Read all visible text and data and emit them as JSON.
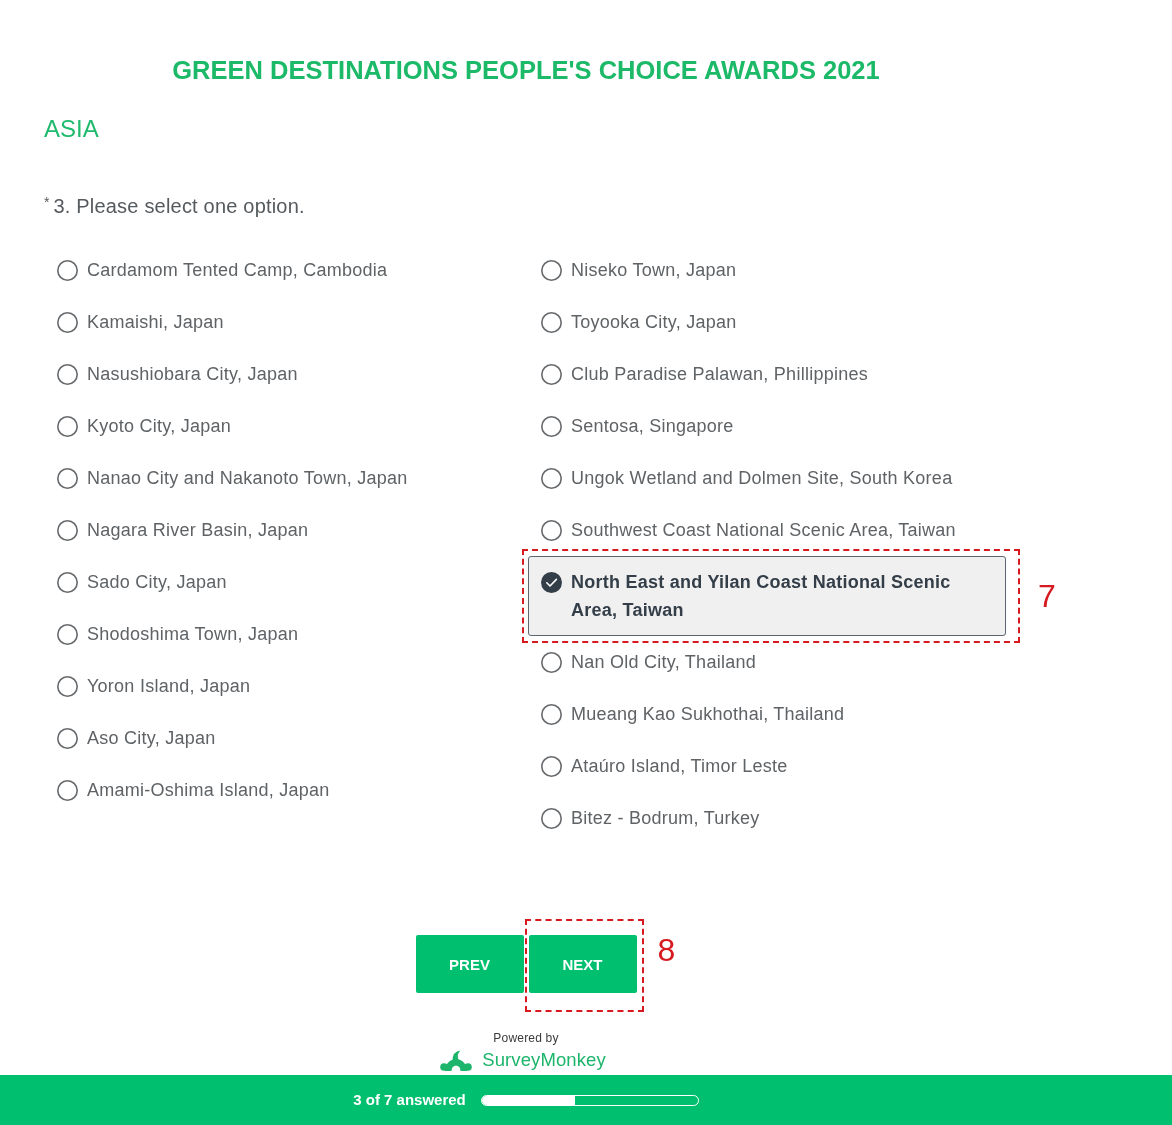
{
  "title": "GREEN DESTINATIONS PEOPLE'S CHOICE AWARDS 2021",
  "section": "ASIA",
  "question": {
    "required_mark": "*",
    "text": "3. Please select one option.",
    "columns": [
      {
        "options": [
          {
            "label": "Cardamom Tented Camp, Cambodia",
            "selected": false
          },
          {
            "label": "Kamaishi, Japan",
            "selected": false
          },
          {
            "label": "Nasushiobara City, Japan",
            "selected": false
          },
          {
            "label": "Kyoto City, Japan",
            "selected": false
          },
          {
            "label": "Nanao City and Nakanoto Town, Japan",
            "selected": false
          },
          {
            "label": "Nagara River Basin, Japan",
            "selected": false
          },
          {
            "label": "Sado City, Japan",
            "selected": false
          },
          {
            "label": "Shodoshima Town, Japan",
            "selected": false
          },
          {
            "label": "Yoron Island, Japan",
            "selected": false
          },
          {
            "label": "Aso City, Japan",
            "selected": false
          },
          {
            "label": "Amami-Oshima Island, Japan",
            "selected": false
          }
        ]
      },
      {
        "options": [
          {
            "label": "Niseko Town, Japan",
            "selected": false
          },
          {
            "label": "Toyooka City, Japan",
            "selected": false
          },
          {
            "label": "Club Paradise Palawan, Phillippines",
            "selected": false
          },
          {
            "label": "Sentosa, Singapore",
            "selected": false
          },
          {
            "label": "Ungok Wetland and Dolmen Site, South Korea",
            "selected": false
          },
          {
            "label": "Southwest Coast National Scenic Area, Taiwan",
            "selected": false
          },
          {
            "label": "North East and Yilan Coast National Scenic Area, Taiwan",
            "selected": true,
            "callout": "7"
          },
          {
            "label": "Nan Old City, Thailand",
            "selected": false
          },
          {
            "label": "Mueang Kao Sukhothai, Thailand",
            "selected": false
          },
          {
            "label": "Ataúro Island, Timor Leste",
            "selected": false
          },
          {
            "label": "Bitez - Bodrum, Turkey",
            "selected": false
          }
        ]
      }
    ]
  },
  "buttons": [
    {
      "label": "PREV"
    },
    {
      "label": "NEXT",
      "callout": "8"
    }
  ],
  "branding": {
    "caption": "Powered by",
    "name": "SurveyMonkey"
  },
  "progress": {
    "label": "3 of 7 answered",
    "level": 0.43
  }
}
